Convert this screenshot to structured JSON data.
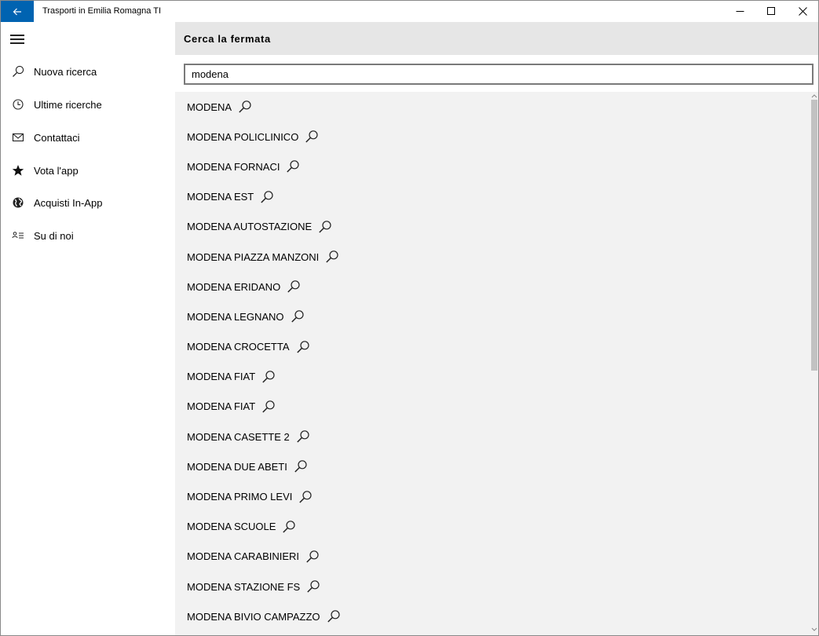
{
  "window": {
    "title": "Trasporti in Emilia Romagna TI"
  },
  "sidebar": {
    "items": [
      {
        "label": "Nuova ricerca",
        "icon": "search-icon"
      },
      {
        "label": "Ultime ricerche",
        "icon": "clock-icon"
      },
      {
        "label": "Contattaci",
        "icon": "mail-icon"
      },
      {
        "label": "Vota l'app",
        "icon": "star-icon"
      },
      {
        "label": "Acquisti In-App",
        "icon": "globe-icon"
      },
      {
        "label": "Su di noi",
        "icon": "contact-card-icon"
      }
    ]
  },
  "main": {
    "title": "Cerca la fermata",
    "search": {
      "value": "modena"
    },
    "results": [
      "MODENA",
      "MODENA POLICLINICO",
      "MODENA FORNACI",
      "MODENA EST",
      "MODENA AUTOSTAZIONE",
      "MODENA PIAZZA MANZONI",
      "MODENA ERIDANO",
      "MODENA LEGNANO",
      "MODENA CROCETTA",
      "MODENA FIAT",
      "MODENA FIAT",
      "MODENA CASETTE 2",
      "MODENA DUE ABETI",
      "MODENA PRIMO LEVI",
      "MODENA SCUOLE",
      "MODENA CARABINIERI",
      "MODENA STAZIONE FS",
      "MODENA BIVIO CAMPAZZO"
    ]
  },
  "colors": {
    "accent": "#0063b1",
    "header_bg": "#e6e6e6",
    "content_bg": "#f2f2f2"
  }
}
